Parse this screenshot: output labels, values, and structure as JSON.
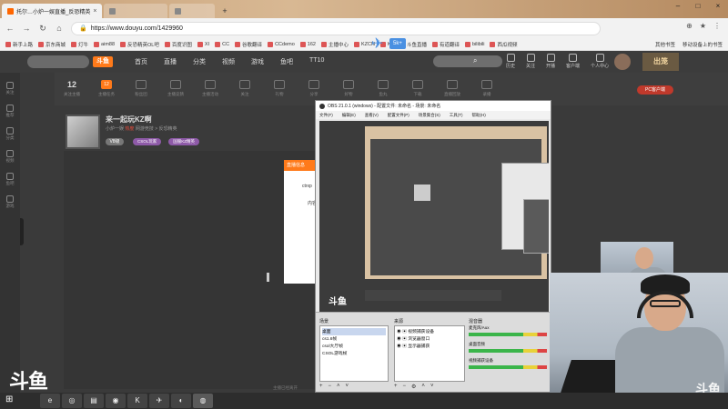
{
  "browser": {
    "tabs": [
      {
        "title": "托尔…小炉一娱直播_反恐精英",
        "active": true
      },
      {
        "title": "",
        "active": false
      },
      {
        "title": "",
        "active": false
      }
    ],
    "url": "https://www.douyu.com/1429960",
    "bookmarks": [
      "新手上路",
      "京东商城",
      "灯牛",
      "aim88",
      "反恐精英OL吧",
      "百度识图",
      "XI",
      "CC",
      "谷歌翻译",
      "CCdemo",
      "162",
      "主播中心",
      "KZCN",
      "KZ",
      "斗鱼直播",
      "有道翻译",
      "bilibili",
      "西瓜视频"
    ],
    "bookmarks_right": [
      "其他书签",
      "移动设备上的书签"
    ],
    "float_badge": "5k+"
  },
  "site": {
    "logo_text": "斗鱼",
    "nav": [
      "首页",
      "直播",
      "分类",
      "视频",
      "游戏",
      "鱼吧",
      "TT10"
    ],
    "header_icons": [
      "历史",
      "关注",
      "开播",
      "客户端",
      "个人中心"
    ],
    "game_badge": "出笼"
  },
  "sidebar": [
    "关注",
    "推荐",
    "分类",
    "视频",
    "鱼吧",
    "游戏"
  ],
  "room_toolbar": {
    "count": "12",
    "count_label": "关注主播",
    "badge": "12",
    "items": [
      "主播任务",
      "粉丝团",
      "主播竞猜",
      "主播活动",
      "关注",
      "礼物",
      "分享",
      "好物",
      "鱼丸",
      "下载",
      "直播回放",
      "录播"
    ],
    "record_button": "PC客户端"
  },
  "room": {
    "title": "来一起玩KZ啊",
    "meta_user": "小炉一娱",
    "meta_hot": "热度",
    "meta_tail": "网游竞技 > 反恐精英",
    "level": "V8级",
    "tags": [
      "CSOL玩家",
      "国服KZ精英"
    ]
  },
  "popup": {
    "header": "直播信息",
    "text1": "ctrxp",
    "text2": "内容"
  },
  "player": {
    "note": "主播已经离开"
  },
  "obs": {
    "title": "OBS 21.0.1 (windows) - 配置文件: 未命名 - 场景: 未命名",
    "menu": [
      "文件(F)",
      "编辑(E)",
      "查看(V)",
      "配置文件(P)",
      "场景集合(S)",
      "工具(T)",
      "帮助(H)"
    ],
    "scenes_title": "场景",
    "scenes": [
      "桌面",
      "cs1.6帧",
      "csol大厅帧",
      "CSOL游戏帧"
    ],
    "sources_title": "来源",
    "sources": [
      "视频捕获设备",
      "浏览器窗口",
      "显示器捕获"
    ],
    "mixer_title": "混音器",
    "mixer": [
      "麦克风/Aux",
      "桌面音频",
      "视频捕获设备"
    ],
    "logo": "斗鱼"
  },
  "watermark": "斗鱼",
  "cam_watermark": "斗鱼",
  "taskbar": {
    "start": "⊞",
    "apps": [
      "e",
      "◎",
      "▤",
      "◉",
      "K",
      "✈",
      "◐",
      "◍"
    ]
  }
}
